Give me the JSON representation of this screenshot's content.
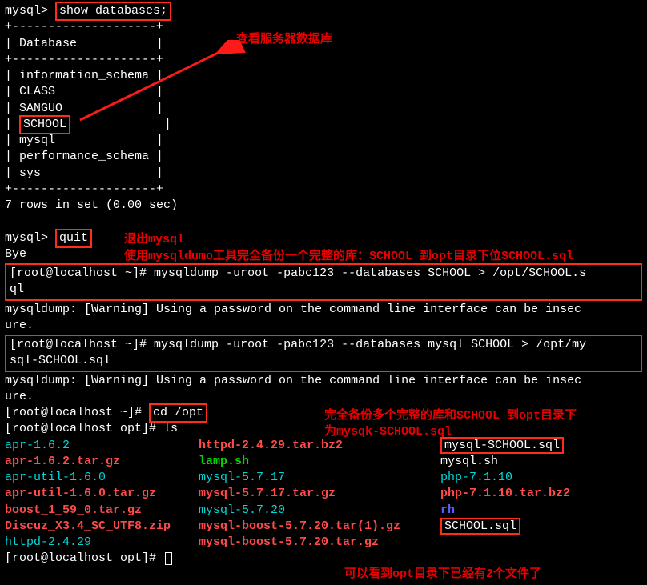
{
  "prompts": {
    "mysql": "mysql>",
    "root_home": "[root@localhost ~]#",
    "root_opt": "[root@localhost opt]#"
  },
  "cmd": {
    "show_databases": "show databases;",
    "quit": "quit",
    "dump1": "mysqldump -uroot -pabc123 --databases SCHOOL > /opt/SCHOOL.s",
    "dump1_cont": "ql",
    "dump2": "mysqldump -uroot -pabc123 --databases mysql SCHOOL > /opt/my",
    "dump2_cont": "sql-SCHOOL.sql",
    "cd_opt": "cd /opt",
    "ls": "ls"
  },
  "db_header": "Database",
  "db_list": [
    "information_schema",
    "CLASS",
    "SANGUO",
    "SCHOOL",
    "mysql",
    "performance_schema",
    "sys"
  ],
  "rows_msg": "7 rows in set (0.00 sec)",
  "bye": "Bye",
  "warn_line1": "mysqldump: [Warning] Using a password on the command line interface can be insec",
  "warn_line1_cont": "ure.",
  "warn_line2": "mysqldump: [Warning] Using a password on the command line interface can be insec",
  "warn_line2_cont": "ure.",
  "sep": "+--------------------+",
  "ls_output": {
    "col1": [
      "apr-1.6.2",
      "apr-1.6.2.tar.gz",
      "apr-util-1.6.0",
      "apr-util-1.6.0.tar.gz",
      "boost_1_59_0.tar.gz",
      "Discuz_X3.4_SC_UTF8.zip",
      "httpd-2.4.29"
    ],
    "col2": [
      "httpd-2.4.29.tar.bz2",
      "lamp.sh",
      "mysql-5.7.17",
      "mysql-5.7.17.tar.gz",
      "mysql-5.7.20",
      "mysql-boost-5.7.20.tar(1).gz",
      "mysql-boost-5.7.20.tar.gz"
    ],
    "col3": [
      "mysql-SCHOOL.sql",
      "mysql.sh",
      "php-7.1.10",
      "php-7.1.10.tar.bz2",
      "rh",
      "SCHOOL.sql",
      ""
    ]
  },
  "annotations": {
    "a1": "查看服务器数据库",
    "a2": "退出mysql",
    "a3": "使用mysqldumo工具完全备份一个完整的库：SCHOOL 到opt目录下位SCHOOL.sql",
    "a4_l1": "完全备份多个完整的库和SCHOOL 到opt目录下",
    "a4_l2": "为mysqk-SCHOOL.sql",
    "a5": "可以看到opt目录下已经有2个文件了"
  }
}
